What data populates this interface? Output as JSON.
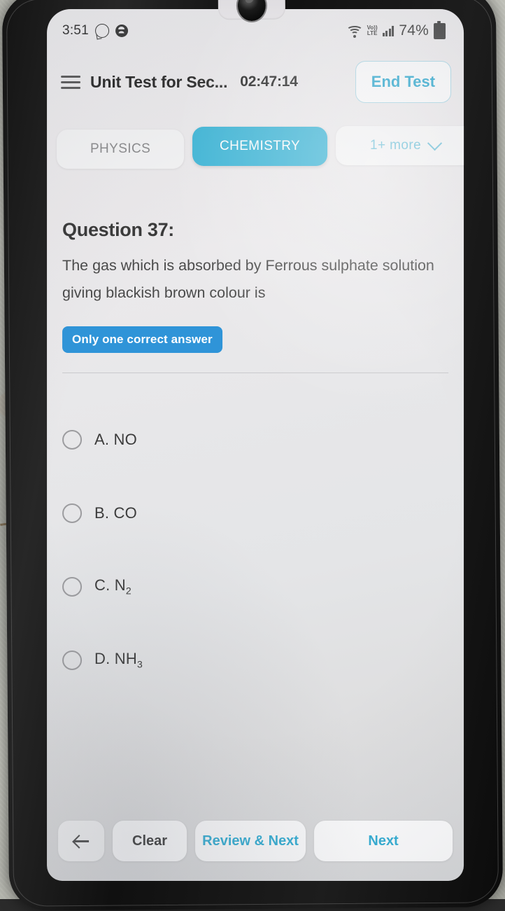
{
  "status_bar": {
    "time": "3:51",
    "icons_left": [
      "whatsapp-icon",
      "person-icon"
    ],
    "network_label": "Vo)) LTE",
    "volte_line1": "Vo))",
    "volte_line2": "LTE",
    "battery_percent": "74%",
    "icons_right": [
      "wifi-icon",
      "volte-icon",
      "signal-bars-icon",
      "battery-icon"
    ]
  },
  "header": {
    "menu_icon": "hamburger-menu-icon",
    "title": "Unit Test for Sec...",
    "timer": "02:47:14",
    "end_test_label": "End Test",
    "end_test_color": "#2aa8d0"
  },
  "tabs": {
    "items": [
      {
        "label": "PHYSICS",
        "state": "inactive"
      },
      {
        "label": "CHEMISTRY",
        "state": "active"
      }
    ],
    "more_label": "1+ more",
    "more_icon": "chevron-down-icon",
    "active_color": "#3fb7d8",
    "inactive_color": "#8d8d8f"
  },
  "question": {
    "number_label": "Question 37:",
    "text": "The gas which is absorbed by Ferrous sulphate solution giving blackish brown colour is",
    "badge": "Only one correct answer",
    "badge_color": "#2f94d8",
    "options": [
      {
        "prefix": "A.",
        "formula": "NO",
        "sub": "",
        "selected": false
      },
      {
        "prefix": "B.",
        "formula": "CO",
        "sub": "",
        "selected": false
      },
      {
        "prefix": "C.",
        "formula": "N",
        "sub": "2",
        "selected": false
      },
      {
        "prefix": "D.",
        "formula": "NH",
        "sub": "3",
        "selected": false
      }
    ]
  },
  "bottom_bar": {
    "back_icon": "arrow-left-icon",
    "clear_label": "Clear",
    "review_next_label": "Review & Next",
    "next_label": "Next",
    "accent_color": "#35aed4"
  }
}
